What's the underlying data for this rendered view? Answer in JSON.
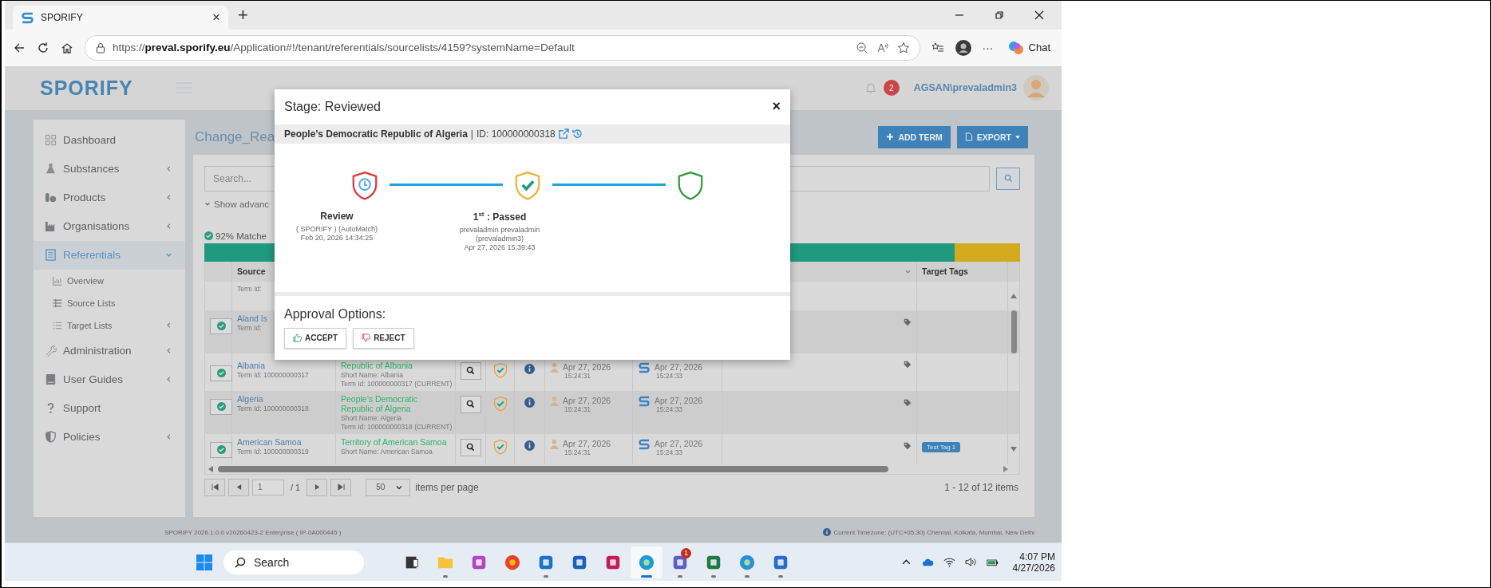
{
  "browser": {
    "tab": {
      "title": "SPORIFY",
      "close": "×"
    },
    "new_tab": "+",
    "address": "https://**preval.sporify.eu**/Application#!/tenant/referentials/sourcelists/4159?systemName=Default",
    "more": "···",
    "chat": "Chat"
  },
  "header": {
    "logo": "SPORIFY",
    "notifications": "2",
    "user": "AGSAN\\prevaladmin3"
  },
  "sidebar": {
    "items": [
      {
        "label": "Dashboard",
        "kind": "dashboard",
        "selected": false
      },
      {
        "label": "Substances",
        "kind": "flask",
        "selected": false,
        "expanded": false
      },
      {
        "label": "Products",
        "kind": "products",
        "selected": false,
        "expanded": false
      },
      {
        "label": "Organisations",
        "kind": "factory",
        "selected": false,
        "expanded": false
      },
      {
        "label": "Referentials",
        "kind": "list",
        "selected": true,
        "expanded": true,
        "children": [
          {
            "label": "Overview",
            "kind": "chart",
            "selected": false
          },
          {
            "label": "Source Lists",
            "kind": "rows",
            "selected": false
          },
          {
            "label": "Target Lists",
            "kind": "lines",
            "selected": false,
            "expanded": false
          }
        ]
      },
      {
        "label": "Administration",
        "kind": "wrench",
        "selected": false,
        "expanded": false
      },
      {
        "label": "User Guides",
        "kind": "book",
        "selected": false,
        "expanded": false
      },
      {
        "label": "Support",
        "kind": "question",
        "selected": false
      },
      {
        "label": "Policies",
        "kind": "shield",
        "selected": false,
        "expanded": false
      }
    ]
  },
  "page": {
    "title": "Change_Rea",
    "buttons": [
      {
        "label": "ADD TERM",
        "kind": "add"
      },
      {
        "label": "EXPORT",
        "kind": "export"
      }
    ],
    "search": {
      "placeholder": "Search..."
    },
    "advanced": "Show advanc",
    "match": {
      "label": "92% Matche",
      "level": 0.92
    }
  },
  "table": {
    "columns": [
      {
        "label": "Source"
      },
      {
        "label": "Target Tags"
      }
    ],
    "rows": [
      {
        "term": "Term Id:"
      },
      {
        "checked": true,
        "name": "Aland Is",
        "term": "Term Id:"
      },
      {
        "checked": true,
        "name": "Albania",
        "term": "Term Id: 100000000317",
        "target_name": "Republic of Albania",
        "short_name": "Short Name: Albania",
        "target_term": "Term Id: 100000000317 (CURRENT)",
        "created": {
          "date": "Apr 27, 2026",
          "time": "15:24:31"
        },
        "updated": {
          "date": "Apr 27, 2026",
          "time": "15:24:33"
        }
      },
      {
        "checked": true,
        "name": "Algeria",
        "term": "Term Id: 100000000318",
        "target_name": "People’s Democratic Republic of Algeria",
        "short_name": "Short Name: Algeria",
        "target_term": "Term Id: 100000000318 (CURRENT)",
        "created": {
          "date": "Apr 27, 2026",
          "time": "15:24:31"
        },
        "updated": {
          "date": "Apr 27, 2026",
          "time": "15:24:33"
        }
      },
      {
        "checked": true,
        "name": "American Samoa",
        "term": "Term Id: 100000000319",
        "target_name": "Territory of American Samoa",
        "short_name": "Short Name: American Samoa",
        "created": {
          "date": "Apr 27, 2026",
          "time": "15:24:31"
        },
        "updated": {
          "date": "Apr 27, 2026",
          "time": "15:24:33"
        },
        "tags": [
          "Test Tag 1"
        ]
      }
    ]
  },
  "pager": {
    "page": "1",
    "total": "/ 1",
    "per_page": "50",
    "per_page_label": "items per page",
    "summary": "1 - 12 of 12 items"
  },
  "footer": {
    "version": "SPORIFY 2026.1.0.0 v20260423-2 Enterprise ( IP-0A000445 )",
    "timezone": "Current Timezone: (UTC+05:30) Chennai, Kolkata, Mumbai, New Delhi"
  },
  "modal": {
    "title": "Stage: Reviewed",
    "close": "×",
    "term_name": "People’s Democratic Republic of Algeria",
    "separator": "|",
    "term_id": "ID: 100000000318",
    "stages": [
      {
        "kind": "clock",
        "color": "#e0343c",
        "title": "Review",
        "lines": [
          "( SPORIFY ) (AutoMatch)",
          "Feb 20, 2026 14:34:25"
        ]
      },
      {
        "kind": "check",
        "color": "#eeb233",
        "title": "1$^{st}$ : Passed",
        "lines": [
          "prevaladmin prevaladmin",
          "(prevaladmin3)",
          "Apr 27, 2026 15:39:43"
        ]
      },
      {
        "kind": "empty",
        "color": "#2f9a3a"
      }
    ],
    "approval_title": "Approval Options:",
    "actions": [
      {
        "label": "ACCEPT",
        "kind": "accept"
      },
      {
        "label": "REJECT",
        "kind": "reject"
      }
    ]
  },
  "taskbar": {
    "search": "Search",
    "apps": [
      {
        "kind": "taskview",
        "running": false,
        "active": false
      },
      {
        "kind": "folder",
        "running": true,
        "active": false
      },
      {
        "kind": "m365",
        "running": false,
        "active": false
      },
      {
        "kind": "chrome",
        "running": false,
        "active": false
      },
      {
        "kind": "outlook",
        "running": true,
        "active": false
      },
      {
        "kind": "store",
        "running": false,
        "active": false
      },
      {
        "kind": "ide",
        "running": false,
        "active": false
      },
      {
        "kind": "edge",
        "running": true,
        "active": true
      },
      {
        "kind": "teams",
        "running": true,
        "active": false,
        "badge": "1"
      },
      {
        "kind": "excel",
        "running": true,
        "active": false
      },
      {
        "kind": "edgedev",
        "running": true,
        "active": false
      },
      {
        "kind": "word",
        "running": true,
        "active": false
      }
    ],
    "time": "4:07 PM",
    "date": "4/27/2026"
  }
}
